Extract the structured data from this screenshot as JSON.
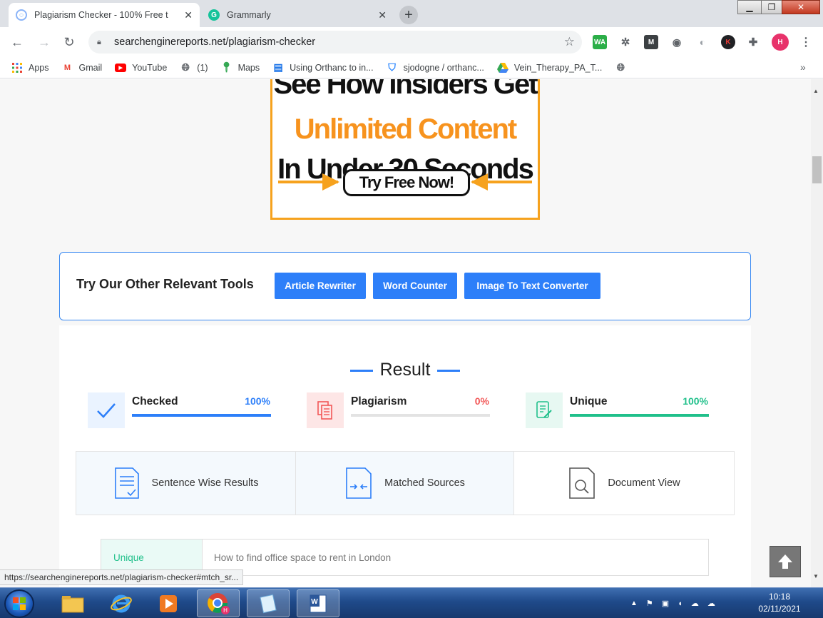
{
  "browser": {
    "tabs": [
      {
        "title": "Plagiarism Checker - 100% Free t",
        "close": "✕",
        "active": true
      },
      {
        "title": "Grammarly",
        "close": "✕",
        "active": false
      }
    ],
    "new_tab": "+",
    "window_controls": {
      "minimize": "▁",
      "restore": "❐",
      "close": "✕"
    },
    "url": "searchenginereports.net/plagiarism-checker",
    "extensions": [
      "WA",
      "K",
      "H"
    ]
  },
  "bookmarks": [
    {
      "label": "Apps",
      "icon": "apps-grid-icon"
    },
    {
      "label": "Gmail",
      "icon": "gmail-icon"
    },
    {
      "label": "YouTube",
      "icon": "youtube-icon"
    },
    {
      "label": "(1)",
      "icon": "globe-icon"
    },
    {
      "label": "Maps",
      "icon": "maps-pin-icon"
    },
    {
      "label": "Using Orthanc to in...",
      "icon": "bookmark-page-icon"
    },
    {
      "label": "sjodogne / orthanc...",
      "icon": "bitbucket-icon"
    },
    {
      "label": "Vein_Therapy_PA_T...",
      "icon": "drive-icon"
    }
  ],
  "bookmarks_more": "»",
  "ad": {
    "line1": "See How Insiders Get",
    "line2": "Unlimited Content",
    "line3": "In Under 30 Seconds",
    "cta": "Try Free Now!"
  },
  "tools": {
    "title": "Try Our Other Relevant Tools",
    "buttons": [
      "Article Rewriter",
      "Word Counter",
      "Image To Text Converter"
    ]
  },
  "result": {
    "title": "Result",
    "stats": [
      {
        "label": "Checked",
        "value": "100%",
        "fill": 1.0,
        "color": "#2d7ff9"
      },
      {
        "label": "Plagiarism",
        "value": "0%",
        "fill": 0.0,
        "color": "#f25757"
      },
      {
        "label": "Unique",
        "value": "100%",
        "fill": 1.0,
        "color": "#21c08b"
      }
    ],
    "tabs": [
      "Sentence Wise Results",
      "Matched Sources",
      "Document View"
    ],
    "rows": [
      {
        "status": "Unique",
        "text": "How to find office space to rent in London"
      }
    ]
  },
  "status_bar_url": "https://searchenginereports.net/plagiarism-checker#mtch_sr...",
  "taskbar": {
    "time": "10:18",
    "date": "02/11/2021"
  }
}
